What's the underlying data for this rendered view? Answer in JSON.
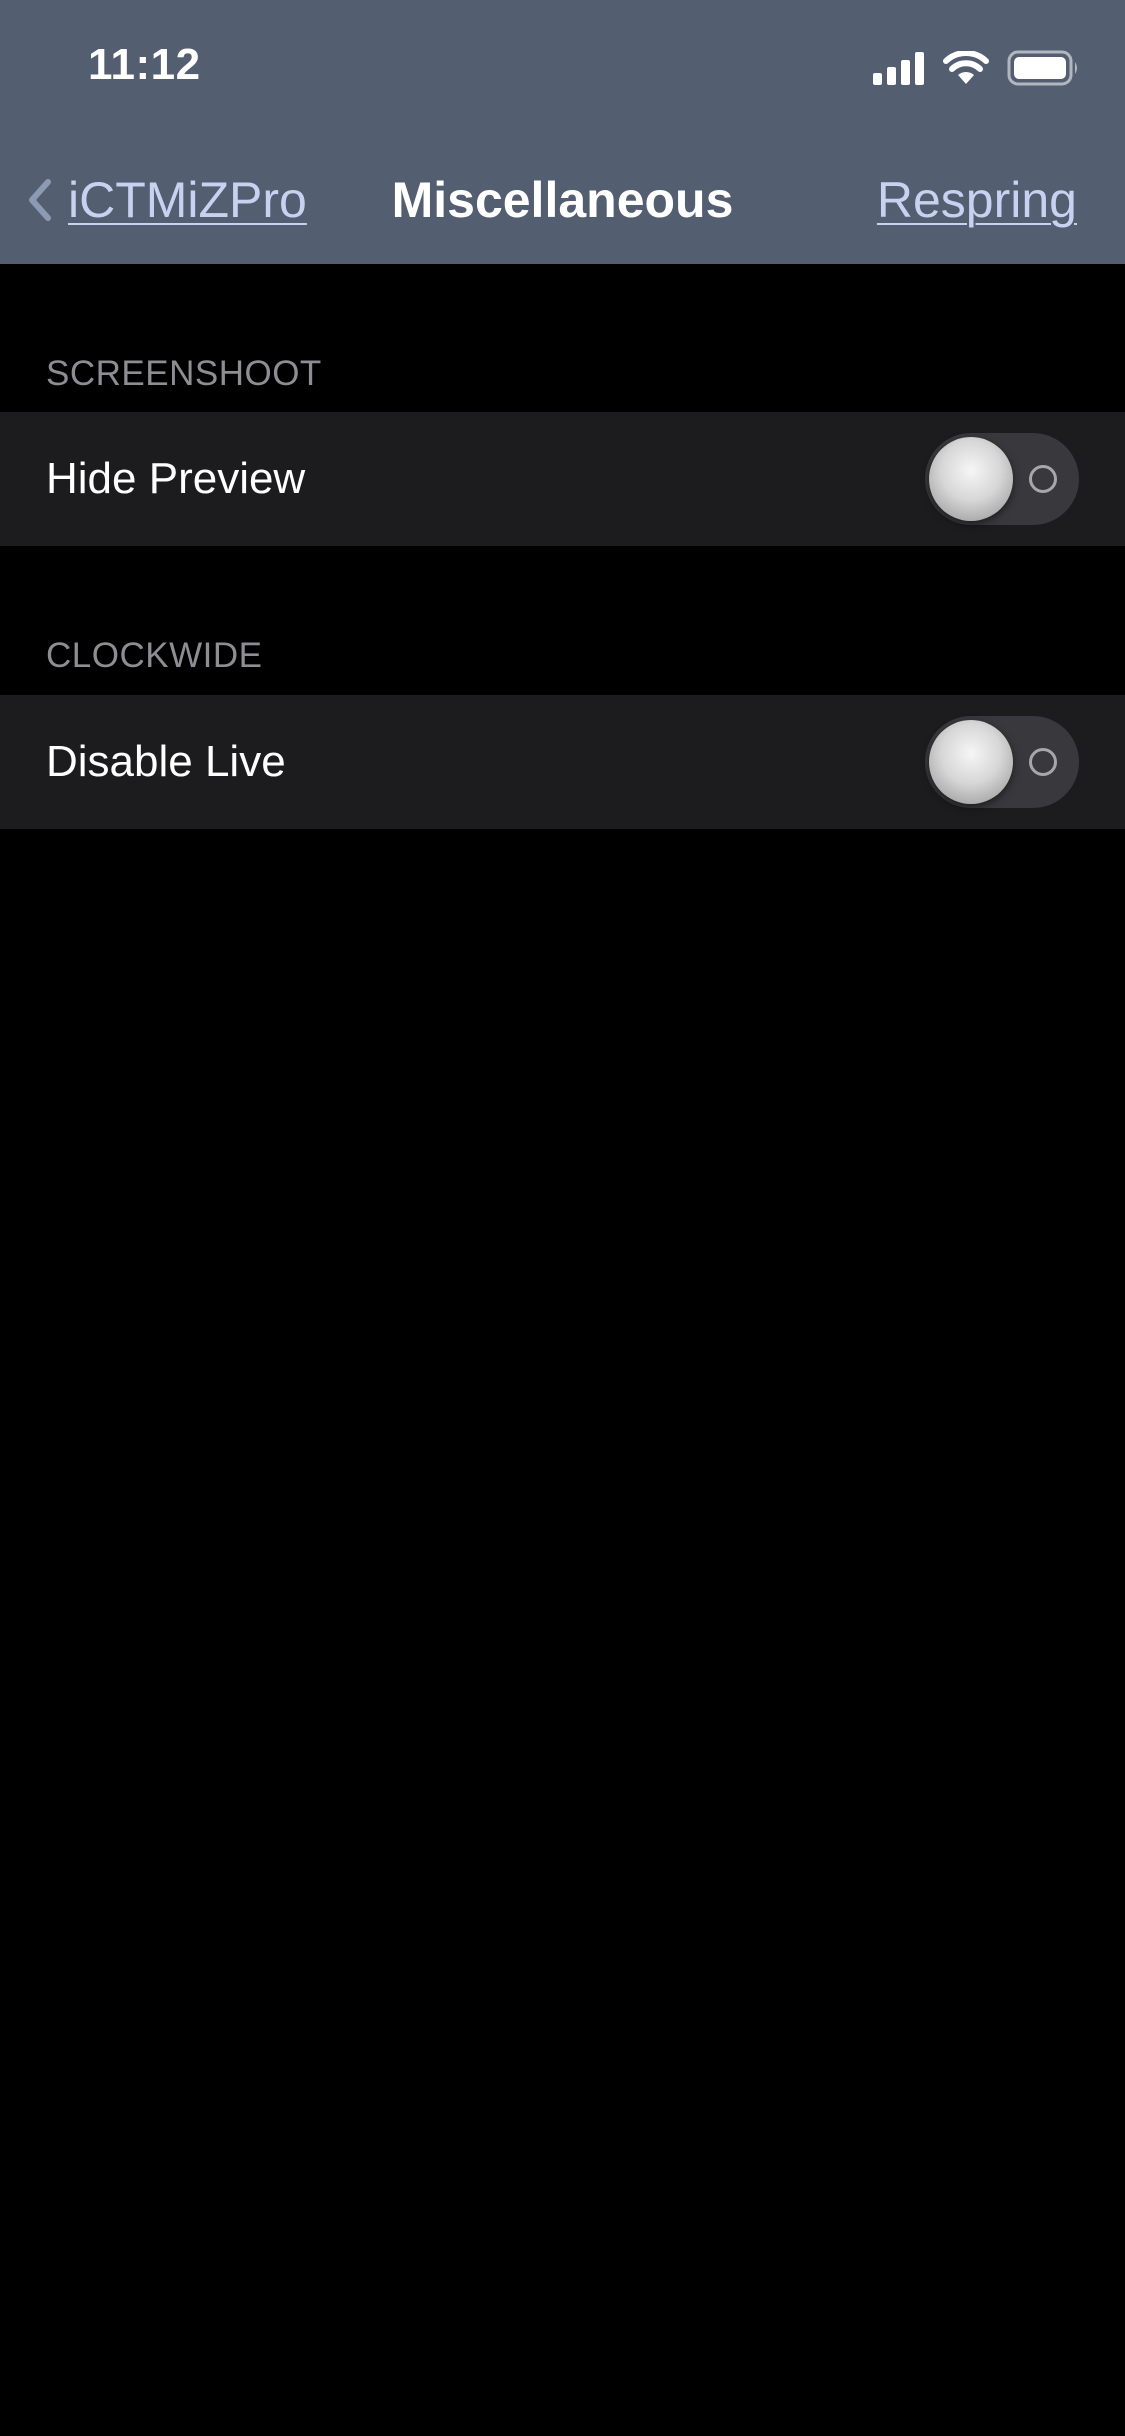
{
  "status_bar": {
    "time": "11:12",
    "battery_level": 0.8
  },
  "nav": {
    "back_label": "iCTMiZPro",
    "title": "Miscellaneous",
    "right_button": "Respring"
  },
  "sections": [
    {
      "header": "SCREENSHOOT",
      "rows": [
        {
          "label": "Hide Preview",
          "switch_on": false
        }
      ]
    },
    {
      "header": "CLOCKWIDE",
      "rows": [
        {
          "label": "Disable Live",
          "switch_on": false
        }
      ]
    }
  ],
  "colors": {
    "nav_background": "#535e71",
    "link": "#c6d2ef",
    "page_background": "#000000",
    "cell_background": "#1c1c1e",
    "section_header_text": "#8d8d93",
    "switch_track_off": "#39393d"
  }
}
